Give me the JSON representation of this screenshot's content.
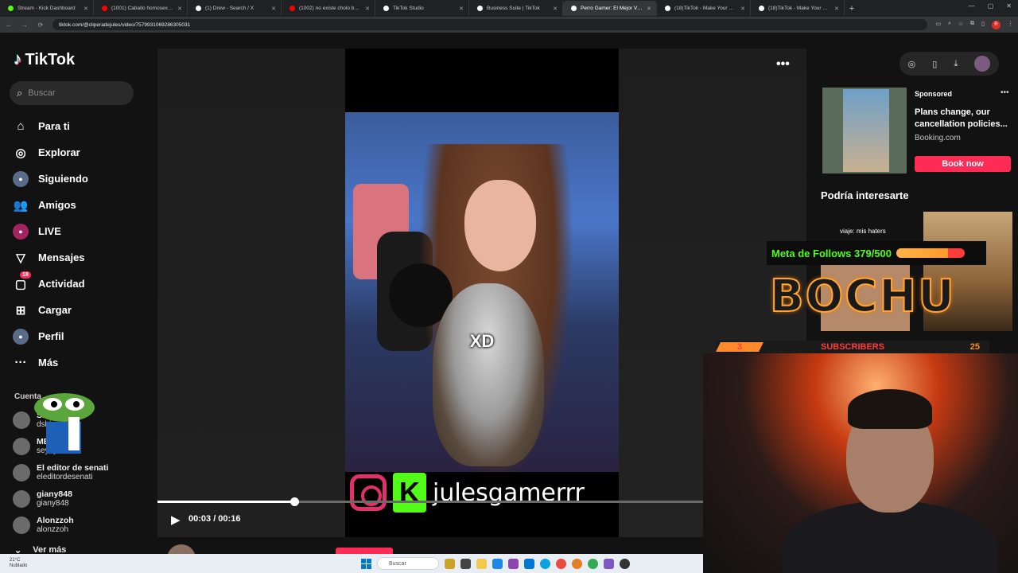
{
  "browser": {
    "tabs": [
      {
        "title": "Stream - Kick Dashboard",
        "color": "#53fc18"
      },
      {
        "title": "(1001) Caballo homosexual de",
        "color": "#ff0000"
      },
      {
        "title": "(1) Drew - Search / X",
        "color": "#ffffff"
      },
      {
        "title": "(1002) no existe cholo bueno -",
        "color": "#ff0000"
      },
      {
        "title": "TikTok Studio",
        "color": "#ffffff"
      },
      {
        "title": "Business Suite | TikTok",
        "color": "#ffffff"
      },
      {
        "title": "Perro Gamer: El Mejor Video de",
        "color": "#ffffff",
        "active": true
      },
      {
        "title": "(18)TikTok - Make Your Day",
        "color": "#ffffff"
      },
      {
        "title": "(18)TikTok - Make Your Day",
        "color": "#ffffff"
      }
    ],
    "url": "tiktok.com/@cliperadejules/video/7579931069286305031",
    "profile_initial": "R"
  },
  "sidebar": {
    "logo": "TikTok",
    "search_placeholder": "Buscar",
    "nav": [
      {
        "label": "Para ti",
        "icon": "home-icon",
        "glyph": "⌂"
      },
      {
        "label": "Explorar",
        "icon": "compass-icon",
        "glyph": "◎"
      },
      {
        "label": "Siguiendo",
        "icon": "following-avatar-icon",
        "glyph": "●"
      },
      {
        "label": "Amigos",
        "icon": "friends-icon",
        "glyph": "👥"
      },
      {
        "label": "LIVE",
        "icon": "live-icon",
        "glyph": "●"
      },
      {
        "label": "Mensajes",
        "icon": "messages-icon",
        "glyph": "▽"
      },
      {
        "label": "Actividad",
        "icon": "activity-icon",
        "glyph": "▢",
        "badge": "18"
      },
      {
        "label": "Cargar",
        "icon": "upload-icon",
        "glyph": "⊞"
      },
      {
        "label": "Perfil",
        "icon": "profile-avatar-icon",
        "glyph": "●"
      },
      {
        "label": "Más",
        "icon": "more-icon",
        "glyph": "···"
      }
    ],
    "accounts_title": "Cuenta",
    "accounts": [
      {
        "name": "S...",
        "handle": "dship"
      },
      {
        "name": "MENDYR",
        "handle": "seyeyor"
      },
      {
        "name": "El editor de senati",
        "handle": "eleditordesenati"
      },
      {
        "name": "giany848",
        "handle": "giany848"
      },
      {
        "name": "Alonzzoh",
        "handle": "alonzzoh"
      }
    ],
    "see_more": "Ver más"
  },
  "video": {
    "caption": "XD",
    "handle": "julesgamerrr",
    "time": "00:03 / 00:16",
    "progress": 0.25,
    "author": "cliperadejules"
  },
  "right": {
    "ad": {
      "sponsored": "Sponsored",
      "text": "Plans change, our cancellation policies...",
      "domain": "Booking.com",
      "cta": "Book now"
    },
    "interest_title": "Podría interesarte",
    "suggestion_caption": "viaje: mis haters"
  },
  "stream_overlay": {
    "goal_label": "Meta de Follows 379/500",
    "goal_fraction": 0.758,
    "brand": "BOCHU",
    "subs_left": "3",
    "subs_label": "SUBSCRIBERS",
    "subs_right": "25"
  },
  "taskbar": {
    "temp": "21°C",
    "weather": "Nublado",
    "search_placeholder": "Buscar"
  }
}
